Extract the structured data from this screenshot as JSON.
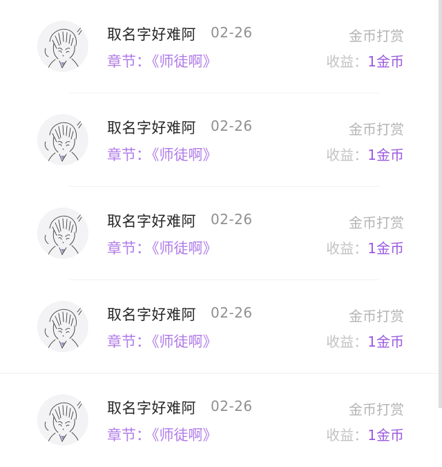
{
  "records": [
    {
      "name": "取名字好难阿",
      "date": "02-26",
      "type": "金币打赏",
      "chapter_label": "章节：",
      "chapter": "《师徒啊》",
      "earn_label": "收益：",
      "earn_value": "1金币"
    },
    {
      "name": "取名字好难阿",
      "date": "02-26",
      "type": "金币打赏",
      "chapter_label": "章节：",
      "chapter": "《师徒啊》",
      "earn_label": "收益：",
      "earn_value": "1金币"
    },
    {
      "name": "取名字好难阿",
      "date": "02-26",
      "type": "金币打赏",
      "chapter_label": "章节：",
      "chapter": "《师徒啊》",
      "earn_label": "收益：",
      "earn_value": "1金币"
    },
    {
      "name": "取名字好难阿",
      "date": "02-26",
      "type": "金币打赏",
      "chapter_label": "章节：",
      "chapter": "《师徒啊》",
      "earn_label": "收益：",
      "earn_value": "1金币"
    },
    {
      "name": "取名字好难阿",
      "date": "02-26",
      "type": "金币打赏",
      "chapter_label": "章节：",
      "chapter": "《师徒啊》",
      "earn_label": "收益：",
      "earn_value": "1金币"
    }
  ],
  "colors": {
    "name": "#262626",
    "date": "#8f8f8f",
    "type": "#b4b4b4",
    "chapter": "#b07be8",
    "earn_value": "#9a59e0"
  },
  "icons": {
    "avatar": "anime-avatar-icon"
  }
}
